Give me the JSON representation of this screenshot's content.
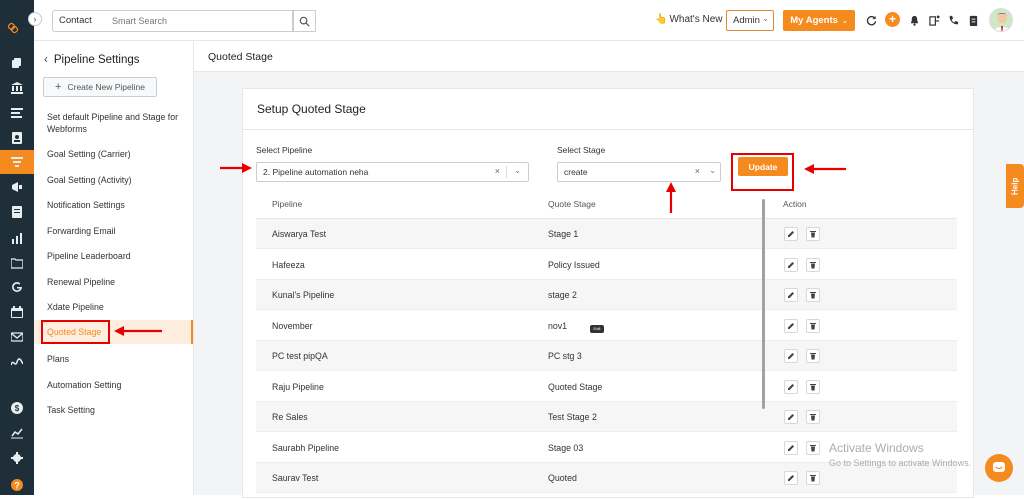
{
  "topbar": {
    "contact_select": "Contact",
    "search_placeholder": "Smart Search",
    "whats_new": "What's New",
    "admin_select": "Admin",
    "my_agents": "My Agents"
  },
  "sidebar": {
    "title": "Pipeline Settings",
    "create_button": "Create New Pipeline",
    "items": [
      {
        "label": "Set default Pipeline and Stage for Webforms"
      },
      {
        "label": "Goal Setting (Carrier)"
      },
      {
        "label": "Goal Setting (Activity)"
      },
      {
        "label": "Notification Settings"
      },
      {
        "label": "Forwarding Email"
      },
      {
        "label": "Pipeline Leaderboard"
      },
      {
        "label": "Renewal Pipeline"
      },
      {
        "label": "Xdate Pipeline"
      },
      {
        "label": "Quoted Stage"
      },
      {
        "label": "Plans"
      },
      {
        "label": "Automation Setting"
      },
      {
        "label": "Task Setting"
      }
    ],
    "active_item": "Quoted Stage"
  },
  "main": {
    "page_title": "Quoted Stage",
    "card_title": "Setup Quoted Stage",
    "select_pipeline_label": "Select Pipeline",
    "select_pipeline_value": "2. Pipeline automation neha",
    "select_stage_label": "Select Stage",
    "select_stage_value": "create",
    "update_button": "Update",
    "table": {
      "headers": [
        "Pipeline",
        "Quote Stage",
        "Action"
      ],
      "rows": [
        {
          "pipeline": "Aiswarya Test",
          "stage": "Stage 1"
        },
        {
          "pipeline": "Hafeeza",
          "stage": "Policy Issued"
        },
        {
          "pipeline": "Kunal's Pipeline",
          "stage": "stage 2"
        },
        {
          "pipeline": "November",
          "stage": "nov1"
        },
        {
          "pipeline": "PC test pipQA",
          "stage": "PC stg 3"
        },
        {
          "pipeline": "Raju Pipeline",
          "stage": "Quoted Stage"
        },
        {
          "pipeline": "Re Sales",
          "stage": "Test Stage 2"
        },
        {
          "pipeline": "Saurabh Pipeline",
          "stage": "Stage 03"
        },
        {
          "pipeline": "Saurav Test",
          "stage": "Quoted"
        }
      ],
      "tooltip": "Edit"
    }
  },
  "help_tab": "Help",
  "watermark": {
    "line1": "Activate Windows",
    "line2": "Go to Settings to activate Windows."
  },
  "colors": {
    "accent": "#f58b1f",
    "rail": "#1f2f3a",
    "annotation": "#e60000"
  }
}
